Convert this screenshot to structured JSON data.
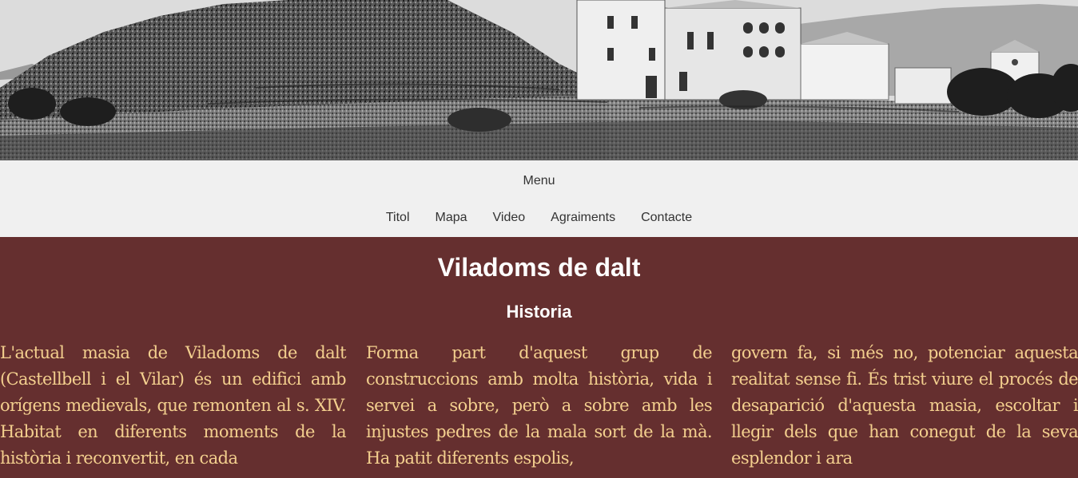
{
  "hero": {
    "image_description_icon": "landscape-photo-icon"
  },
  "nav": {
    "toggle_label": "Menu",
    "links": [
      "Titol",
      "Mapa",
      "Video",
      "Agraiments",
      "Contacte"
    ]
  },
  "main": {
    "title": "Viladoms de dalt",
    "subtitle": "Historia",
    "columns": [
      "L'actual masia de Viladoms de dalt (Castellbell i el Vilar) és un edifici amb orígens medievals, que remonten al s. XIV. Habitat en diferents moments de la història i reconvertit, en cada",
      "Forma part d'aquest grup de construccions amb molta història, vida i servei a sobre, però a sobre amb les injustes pedres de la mala sort de la mà. Ha patit diferents espolis,",
      "govern fa, si més no, potenciar aquesta realitat sense fi. És trist viure el procés de desaparició d'aquesta masia, escoltar i llegir dels que han conegut de la seva esplendor i ara"
    ]
  },
  "colors": {
    "background": "#652f2f",
    "nav_background": "#f0f0f0",
    "body_text": "#f3cf8e",
    "heading_text": "#ffffff"
  }
}
